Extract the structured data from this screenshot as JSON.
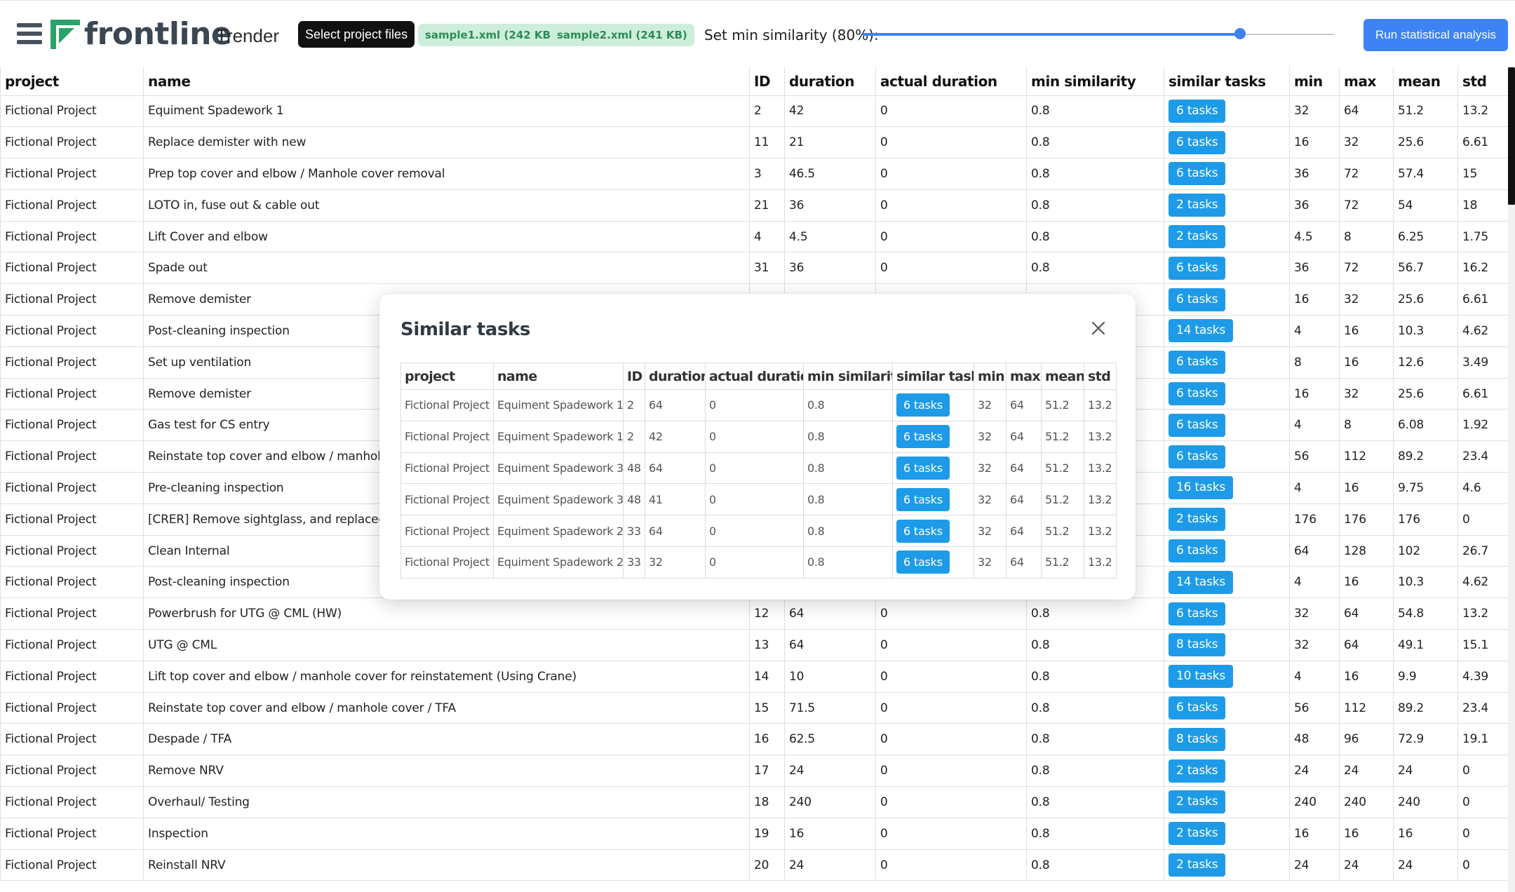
{
  "header": {
    "logo_text": "frontline",
    "app_name": "Trender",
    "select_button": "Select project files",
    "files": [
      "sample1.xml (242 KB)",
      "sample2.xml (241 KB)"
    ],
    "similarity_label": "Set min similarity (80%):",
    "similarity_value": 0.8,
    "run_button": "Run statistical analysis",
    "colors": {
      "accent": "#3e83f6",
      "logo_green": "#2aa46a",
      "tasks_button": "#1d9be8",
      "file_chip_bg": "#cdeedb",
      "file_chip_text": "#2d8c56"
    }
  },
  "table": {
    "columns": [
      "project",
      "name",
      "ID",
      "duration",
      "actual duration",
      "min similarity",
      "similar tasks",
      "min",
      "max",
      "mean",
      "std"
    ],
    "rows": [
      [
        "Fictional Project",
        "Equiment Spadework 1",
        "2",
        "42",
        "0",
        "0.8",
        "6 tasks",
        "32",
        "64",
        "51.2",
        "13.2"
      ],
      [
        "Fictional Project",
        "Replace demister with new",
        "11",
        "21",
        "0",
        "0.8",
        "6 tasks",
        "16",
        "32",
        "25.6",
        "6.61"
      ],
      [
        "Fictional Project",
        "Prep top cover and elbow / Manhole cover removal",
        "3",
        "46.5",
        "0",
        "0.8",
        "6 tasks",
        "36",
        "72",
        "57.4",
        "15"
      ],
      [
        "Fictional Project",
        "LOTO in, fuse out & cable out",
        "21",
        "36",
        "0",
        "0.8",
        "2 tasks",
        "36",
        "72",
        "54",
        "18"
      ],
      [
        "Fictional Project",
        "Lift Cover and elbow",
        "4",
        "4.5",
        "0",
        "0.8",
        "2 tasks",
        "4.5",
        "8",
        "6.25",
        "1.75"
      ],
      [
        "Fictional Project",
        "Spade out",
        "31",
        "36",
        "0",
        "0.8",
        "6 tasks",
        "36",
        "72",
        "56.7",
        "16.2"
      ],
      [
        "Fictional Project",
        "Remove demister",
        "",
        "",
        "",
        "",
        "6 tasks",
        "16",
        "32",
        "25.6",
        "6.61"
      ],
      [
        "Fictional Project",
        "Post-cleaning inspection",
        "",
        "",
        "",
        "",
        "14 tasks",
        "4",
        "16",
        "10.3",
        "4.62"
      ],
      [
        "Fictional Project",
        "Set up ventilation",
        "",
        "",
        "",
        "",
        "6 tasks",
        "8",
        "16",
        "12.6",
        "3.49"
      ],
      [
        "Fictional Project",
        "Remove demister",
        "",
        "",
        "",
        "",
        "6 tasks",
        "16",
        "32",
        "25.6",
        "6.61"
      ],
      [
        "Fictional Project",
        "Gas test for CS entry",
        "",
        "",
        "",
        "",
        "6 tasks",
        "4",
        "8",
        "6.08",
        "1.92"
      ],
      [
        "Fictional Project",
        "Reinstate top cover and elbow / manhole co",
        "",
        "",
        "",
        "",
        "6 tasks",
        "56",
        "112",
        "89.2",
        "23.4"
      ],
      [
        "Fictional Project",
        "Pre-cleaning inspection",
        "",
        "",
        "",
        "",
        "16 tasks",
        "4",
        "16",
        "9.75",
        "4.6"
      ],
      [
        "Fictional Project",
        "[CRER] Remove sightglass, and replaced witl",
        "",
        "",
        "",
        "",
        "2 tasks",
        "176",
        "176",
        "176",
        "0"
      ],
      [
        "Fictional Project",
        "Clean Internal",
        "",
        "",
        "",
        "",
        "6 tasks",
        "64",
        "128",
        "102",
        "26.7"
      ],
      [
        "Fictional Project",
        "Post-cleaning inspection",
        "",
        "",
        "",
        "",
        "14 tasks",
        "4",
        "16",
        "10.3",
        "4.62"
      ],
      [
        "Fictional Project",
        "Powerbrush for UTG @ CML (HW)",
        "12",
        "64",
        "0",
        "0.8",
        "6 tasks",
        "32",
        "64",
        "54.8",
        "13.2"
      ],
      [
        "Fictional Project",
        "UTG @ CML",
        "13",
        "64",
        "0",
        "0.8",
        "8 tasks",
        "32",
        "64",
        "49.1",
        "15.1"
      ],
      [
        "Fictional Project",
        "Lift top cover and elbow / manhole cover for reinstatement (Using Crane)",
        "14",
        "10",
        "0",
        "0.8",
        "10 tasks",
        "4",
        "16",
        "9.9",
        "4.39"
      ],
      [
        "Fictional Project",
        "Reinstate top cover and elbow / manhole cover / TFA",
        "15",
        "71.5",
        "0",
        "0.8",
        "6 tasks",
        "56",
        "112",
        "89.2",
        "23.4"
      ],
      [
        "Fictional Project",
        "Despade / TFA",
        "16",
        "62.5",
        "0",
        "0.8",
        "8 tasks",
        "48",
        "96",
        "72.9",
        "19.1"
      ],
      [
        "Fictional Project",
        "Remove NRV",
        "17",
        "24",
        "0",
        "0.8",
        "2 tasks",
        "24",
        "24",
        "24",
        "0"
      ],
      [
        "Fictional Project",
        "Overhaul/ Testing",
        "18",
        "240",
        "0",
        "0.8",
        "2 tasks",
        "240",
        "240",
        "240",
        "0"
      ],
      [
        "Fictional Project",
        "Inspection",
        "19",
        "16",
        "0",
        "0.8",
        "2 tasks",
        "16",
        "16",
        "16",
        "0"
      ],
      [
        "Fictional Project",
        "Reinstall NRV",
        "20",
        "24",
        "0",
        "0.8",
        "2 tasks",
        "24",
        "24",
        "24",
        "0"
      ]
    ]
  },
  "modal": {
    "title": "Similar tasks",
    "columns": [
      "project",
      "name",
      "ID",
      "duration",
      "actual duration",
      "min similarity",
      "similar tasks",
      "min",
      "max",
      "mean",
      "std"
    ],
    "rows": [
      [
        "Fictional Project",
        "Equiment Spadework 1",
        "2",
        "64",
        "0",
        "0.8",
        "6 tasks",
        "32",
        "64",
        "51.2",
        "13.2"
      ],
      [
        "Fictional Project",
        "Equiment Spadework 1",
        "2",
        "42",
        "0",
        "0.8",
        "6 tasks",
        "32",
        "64",
        "51.2",
        "13.2"
      ],
      [
        "Fictional Project",
        "Equiment Spadework 3",
        "48",
        "64",
        "0",
        "0.8",
        "6 tasks",
        "32",
        "64",
        "51.2",
        "13.2"
      ],
      [
        "Fictional Project",
        "Equiment Spadework 3",
        "48",
        "41",
        "0",
        "0.8",
        "6 tasks",
        "32",
        "64",
        "51.2",
        "13.2"
      ],
      [
        "Fictional Project",
        "Equiment Spadework 2",
        "33",
        "64",
        "0",
        "0.8",
        "6 tasks",
        "32",
        "64",
        "51.2",
        "13.2"
      ],
      [
        "Fictional Project",
        "Equiment Spadework 2",
        "33",
        "32",
        "0",
        "0.8",
        "6 tasks",
        "32",
        "64",
        "51.2",
        "13.2"
      ]
    ]
  }
}
